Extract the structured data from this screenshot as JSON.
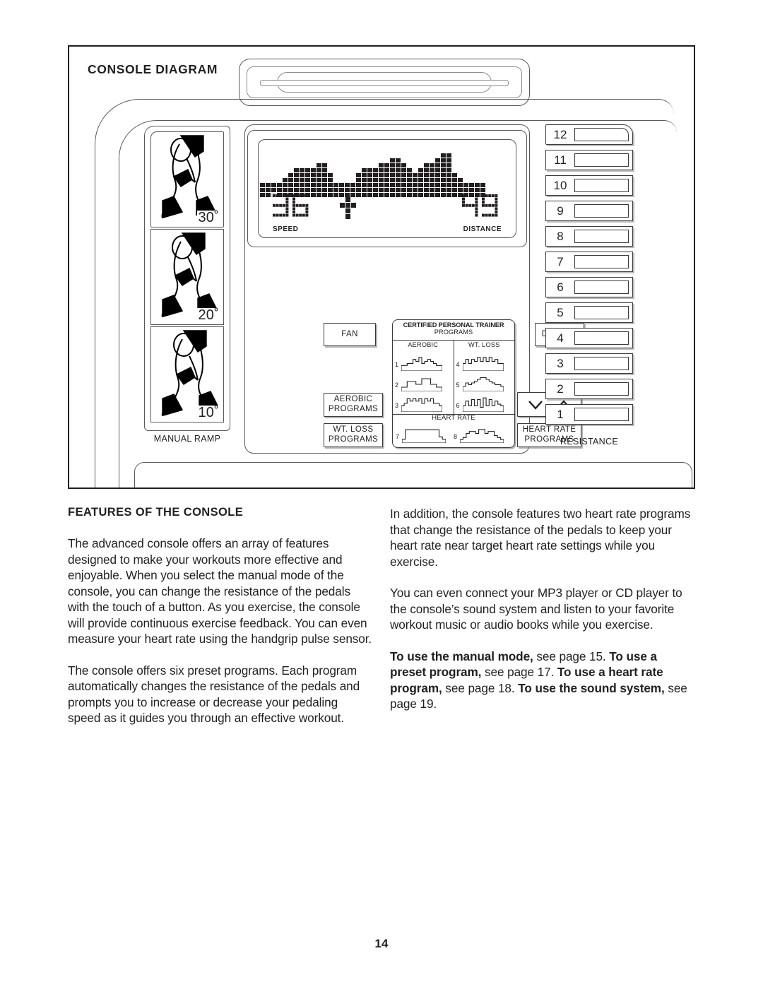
{
  "diagram": {
    "title": "CONSOLE DIAGRAM",
    "manual_ramp": {
      "label": "MANUAL RAMP",
      "cells": [
        {
          "degrees": "30˚",
          "icon": "legs-ramp-30-icon"
        },
        {
          "degrees": "20˚",
          "icon": "legs-ramp-20-icon"
        },
        {
          "degrees": "10˚",
          "icon": "legs-ramp-10-icon"
        }
      ]
    },
    "display": {
      "speed": {
        "value": "36",
        "label": "SPEED"
      },
      "distance": {
        "value": "49",
        "label": "DISTANCE"
      },
      "center_glyph": "cross-icon",
      "matrix_profile": [
        3,
        3,
        3,
        3,
        4,
        5,
        6,
        6,
        6,
        6,
        7,
        7,
        5,
        3,
        3,
        3,
        3,
        5,
        6,
        6,
        6,
        7,
        7,
        8,
        8,
        7,
        6,
        5,
        6,
        7,
        7,
        8,
        9,
        9,
        5,
        4,
        3,
        3,
        3,
        3
      ]
    },
    "buttons": {
      "fan": "FAN",
      "display": "DISPLAY",
      "aerobic_programs": "AEROBIC\nPROGRAMS",
      "aerobic_programs_line1": "AEROBIC",
      "aerobic_programs_line2": "PROGRAMS",
      "wt_loss_programs_line1": "WT. LOSS",
      "wt_loss_programs_line2": "PROGRAMS",
      "heart_rate_programs_line1": "HEART RATE",
      "heart_rate_programs_line2": "PROGRAMS",
      "decrease_icon": "chevron-down-icon",
      "increase_icon": "chevron-up-icon"
    },
    "cpt_panel": {
      "title": "CERTIFIED PERSONAL TRAINER",
      "subtitle": "PROGRAMS",
      "columns": [
        {
          "heading": "AEROBIC",
          "programs": [
            {
              "number": "1",
              "profile": [
                2,
                2,
                3,
                3,
                5,
                4,
                6,
                3,
                4,
                5,
                4,
                3,
                2,
                2
              ]
            },
            {
              "number": "2",
              "profile": [
                1,
                1,
                3,
                3,
                3,
                2,
                2,
                4,
                4,
                4,
                2,
                2,
                1,
                1
              ]
            },
            {
              "number": "3",
              "profile": [
                2,
                3,
                5,
                4,
                5,
                4,
                5,
                3,
                5,
                4,
                5,
                3,
                3,
                2
              ]
            }
          ]
        },
        {
          "heading": "WT. LOSS",
          "programs": [
            {
              "number": "4",
              "profile": [
                3,
                5,
                3,
                5,
                4,
                6,
                4,
                6,
                4,
                6,
                4,
                5,
                3,
                3
              ]
            },
            {
              "number": "5",
              "profile": [
                2,
                4,
                3,
                4,
                5,
                6,
                7,
                7,
                6,
                5,
                4,
                3,
                3,
                2
              ]
            },
            {
              "number": "6",
              "profile": [
                3,
                6,
                3,
                7,
                3,
                7,
                2,
                8,
                3,
                7,
                3,
                6,
                4,
                3
              ]
            }
          ]
        }
      ],
      "heart_rate": {
        "heading": "HEART RATE",
        "programs": [
          {
            "number": "7",
            "profile": [
              1,
              5,
              5,
              5,
              5,
              5,
              5,
              5,
              5,
              5,
              5,
              2,
              1
            ]
          },
          {
            "number": "8",
            "profile": [
              1,
              2,
              4,
              5,
              5,
              4,
              6,
              6,
              4,
              5,
              5,
              3,
              2,
              1
            ]
          }
        ]
      }
    },
    "resistance": {
      "label": "RESISTANCE",
      "levels": [
        "12",
        "11",
        "10",
        "9",
        "8",
        "7",
        "6",
        "5",
        "4",
        "3",
        "2",
        "1"
      ]
    }
  },
  "content": {
    "section_heading": "FEATURES OF THE CONSOLE",
    "left_paragraphs": [
      "The advanced console offers an array of features designed to make your workouts more effective and enjoyable. When you select the manual mode of the console, you can change the resistance of the pedals with the touch of a button. As you exercise, the console will provide continuous exercise feedback. You can even measure your heart rate using the handgrip pulse sensor.",
      "The console offers six preset programs. Each program automatically changes the resistance of the pedals and prompts you to increase or decrease your pedaling speed as it guides you through an effective workout."
    ],
    "right_paragraphs": [
      "In addition, the console features two heart rate programs that change the resistance of the pedals to keep your heart rate near target heart rate settings while you exercise.",
      "You can even connect your MP3 player or CD player to the console’s sound system and listen to your favorite workout music or audio books while you exercise."
    ],
    "cross_reference": {
      "b1": "To use the manual mode,",
      "t1": " see page 15. ",
      "b2": "To use a preset program,",
      "t2": " see page 17. ",
      "b3": "To use a heart rate program,",
      "t3": " see page 18. ",
      "b4": "To use the sound system,",
      "t4": " see page 19."
    }
  },
  "page_number": "14"
}
